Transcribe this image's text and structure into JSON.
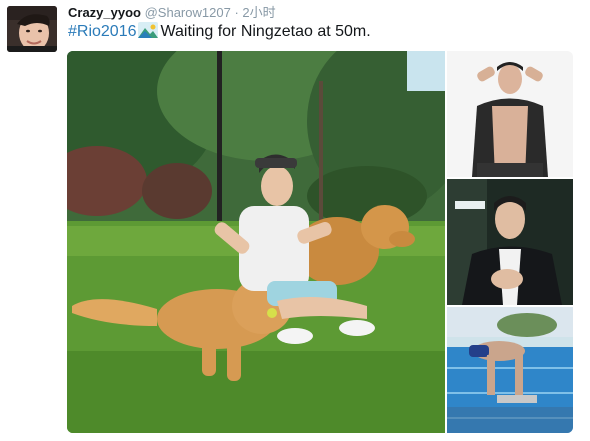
{
  "tweet": {
    "user": {
      "display_name": "Crazy_yyoo",
      "handle": "@Sharow1207",
      "separator": "·",
      "time": "2小时"
    },
    "hashtag": "#Rio2016",
    "emoji_icon": "mountain-icon",
    "text": "Waiting for Ningzetao at 50m.",
    "colors": {
      "link": "#2b7bb9",
      "meta": "#8899a6",
      "text": "#14171a"
    }
  }
}
